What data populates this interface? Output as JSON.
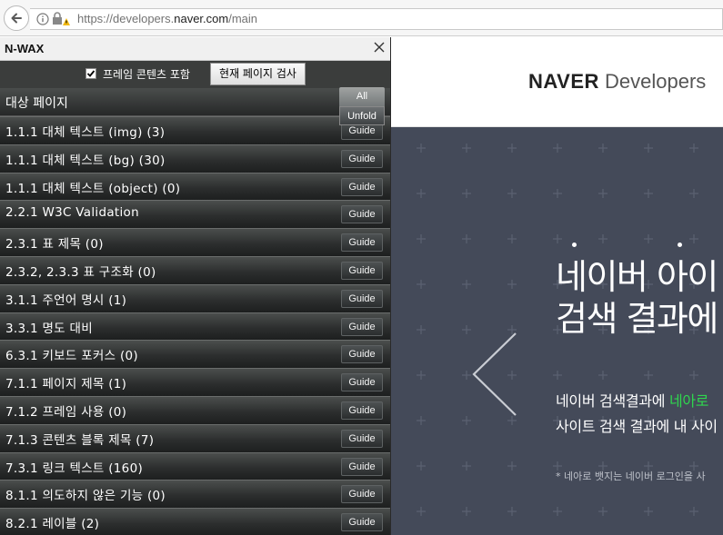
{
  "browser": {
    "url_prefix": "https://developers.",
    "url_domain": "naver.com",
    "url_suffix": "/main"
  },
  "panel": {
    "title": "N-WAX",
    "frame_checkbox_label": "프레임 콘텐츠 포함",
    "frame_checkbox_checked": true,
    "scan_button": "현재 페이지 검사",
    "target_label": "대상 페이지",
    "all_button": "All",
    "unfold_button": "Unfold",
    "guide_label": "Guide",
    "rows": [
      "1.1.1 대체 텍스트 (img) (3)",
      "1.1.1 대체 텍스트 (bg) (30)",
      "1.1.1 대체 텍스트 (object) (0)",
      "2.2.1 W3C Validation",
      "2.3.1 표 제목 (0)",
      "2.3.2, 2.3.3 표 구조화 (0)",
      "3.1.1 주언어 명시 (1)",
      "3.3.1 명도 대비",
      "6.3.1 키보드 포커스 (0)",
      "7.1.1 페이지 제목 (1)",
      "7.1.2 프레임 사용 (0)",
      "7.1.3 콘텐츠 블록 제목 (7)",
      "7.3.1 링크 텍스트 (160)",
      "8.1.1 의도하지 않은 기능 (0)",
      "8.2.1 레이블 (2)"
    ]
  },
  "page": {
    "logo_bold": "NAVER",
    "logo_rest": "Developers",
    "hero_line1": "네이버 아이",
    "hero_line2": "검색 결과에",
    "desc_line1_a": "네이버 검색결과에 ",
    "desc_line1_b": "네아로",
    "desc_line2": "사이트 검색 결과에 내 사이",
    "note": "* 네아로 뱃지는 네이버 로그인을 사",
    "accent_green": "#2fd64e",
    "hero_bg": "#444a59"
  }
}
